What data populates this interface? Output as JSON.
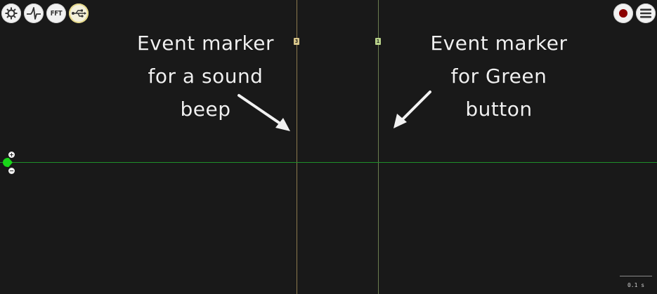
{
  "toolbar_left": {
    "buttons": [
      {
        "name": "config",
        "icon": "gear-icon"
      },
      {
        "name": "threshold",
        "icon": "spike-waveform-icon"
      },
      {
        "name": "fft",
        "label": "FFT"
      },
      {
        "name": "usb",
        "icon": "usb-icon"
      }
    ]
  },
  "toolbar_right": {
    "record_icon": "record-icon",
    "menu_icon": "hamburger-menu-icon",
    "record_color": "#8b0000"
  },
  "event_markers": [
    {
      "label": "3",
      "color": "#d8c68a"
    },
    {
      "label": "1",
      "color": "#b9d28a"
    }
  ],
  "annotations": {
    "beep": [
      "Event marker",
      "for a sound",
      "beep"
    ],
    "green": [
      "Event marker",
      "for Green",
      "button"
    ]
  },
  "channel": {
    "trace_color": "#1f8f2a",
    "handle_color": "#19d619",
    "gain_plus": "+",
    "gain_minus": "−"
  },
  "timescale": {
    "label": "0.1 s"
  },
  "colors": {
    "background": "#191919"
  }
}
